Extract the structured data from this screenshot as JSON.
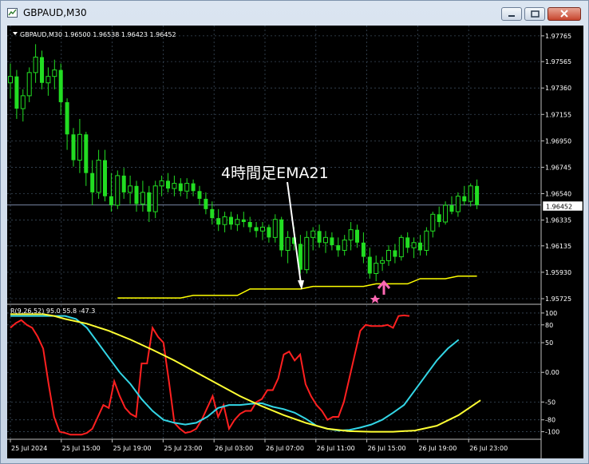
{
  "window": {
    "title": "GBPAUD,M30",
    "controls": [
      "minimize",
      "maximize",
      "close"
    ]
  },
  "main_chart": {
    "header": "GBPAUD,M30  1.96500 1.96538 1.96423 1.96452",
    "annotation": "4時間足EMA21",
    "current_price": "1.96452",
    "price_ticks": [
      "1.97765",
      "1.97565",
      "1.97360",
      "1.97155",
      "1.96950",
      "1.96745",
      "1.96540",
      "1.96335",
      "1.96135",
      "1.95930",
      "1.95725"
    ]
  },
  "sub_chart": {
    "header": "R(9,26,52) 95.0 55.8 -47.3",
    "ticks": [
      "100",
      "80",
      "50",
      "0.00",
      "-50",
      "-80",
      "-100"
    ]
  },
  "time_labels": [
    "25 Jul 2024",
    "25 Jul 15:00",
    "25 Jul 19:00",
    "25 Jul 23:00",
    "26 Jul 03:00",
    "26 Jul 07:00",
    "26 Jul 11:00",
    "26 Jul 15:00",
    "26 Jul 19:00",
    "26 Jul 23:00"
  ],
  "colors": {
    "background": "#000000",
    "grid": "#3a4a5a",
    "candle": "#22dd22",
    "ema": "#ffff00",
    "rci_short": "#ff2020",
    "rci_mid": "#33d6e6",
    "rci_long": "#ffff33",
    "signal": "#ff69b4"
  },
  "chart_data": [
    {
      "type": "candlestick",
      "title": "GBPAUD,M30",
      "ylim": [
        1.957,
        1.9782
      ],
      "price_format": "1.96452",
      "ohlc": [
        [
          1.974,
          1.9755,
          1.9728,
          1.9745
        ],
        [
          1.9745,
          1.975,
          1.9712,
          1.972
        ],
        [
          1.972,
          1.9735,
          1.971,
          1.973
        ],
        [
          1.973,
          1.9752,
          1.9725,
          1.9748
        ],
        [
          1.9748,
          1.977,
          1.974,
          1.976
        ],
        [
          1.976,
          1.9765,
          1.9735,
          1.974
        ],
        [
          1.974,
          1.9752,
          1.973,
          1.9745
        ],
        [
          1.9745,
          1.9758,
          1.9735,
          1.975
        ],
        [
          1.975,
          1.9755,
          1.9715,
          1.9725
        ],
        [
          1.9725,
          1.9728,
          1.9688,
          1.97
        ],
        [
          1.97,
          1.9705,
          1.9675,
          1.968
        ],
        [
          1.968,
          1.9712,
          1.967,
          1.97
        ],
        [
          1.97,
          1.9702,
          1.966,
          1.967
        ],
        [
          1.967,
          1.968,
          1.9645,
          1.9655
        ],
        [
          1.9655,
          1.9688,
          1.965,
          1.968
        ],
        [
          1.968,
          1.9688,
          1.9648,
          1.9652
        ],
        [
          1.9652,
          1.967,
          1.964,
          1.9645
        ],
        [
          1.9645,
          1.9672,
          1.9642,
          1.9668
        ],
        [
          1.9668,
          1.9674,
          1.965,
          1.9655
        ],
        [
          1.9655,
          1.9668,
          1.9646,
          1.966
        ],
        [
          1.966,
          1.9664,
          1.964,
          1.9646
        ],
        [
          1.9646,
          1.9664,
          1.964,
          1.9655
        ],
        [
          1.9655,
          1.966,
          1.9632,
          1.964
        ],
        [
          1.964,
          1.9664,
          1.9635,
          1.966
        ],
        [
          1.966,
          1.9668,
          1.9652,
          1.9664
        ],
        [
          1.9664,
          1.967,
          1.9655,
          1.9658
        ],
        [
          1.9658,
          1.9668,
          1.9652,
          1.9662
        ],
        [
          1.9662,
          1.9666,
          1.9652,
          1.9656
        ],
        [
          1.9656,
          1.9666,
          1.965,
          1.9662
        ],
        [
          1.9662,
          1.9665,
          1.9652,
          1.9656
        ],
        [
          1.9656,
          1.966,
          1.9645,
          1.965
        ],
        [
          1.965,
          1.9655,
          1.9638,
          1.9642
        ],
        [
          1.9642,
          1.9648,
          1.963,
          1.9635
        ],
        [
          1.9635,
          1.9642,
          1.9625,
          1.963
        ],
        [
          1.963,
          1.964,
          1.9624,
          1.9636
        ],
        [
          1.9636,
          1.964,
          1.9626,
          1.963
        ],
        [
          1.963,
          1.9638,
          1.9625,
          1.9634
        ],
        [
          1.9634,
          1.964,
          1.9628,
          1.9632
        ],
        [
          1.9632,
          1.9636,
          1.9624,
          1.9628
        ],
        [
          1.9628,
          1.9632,
          1.962,
          1.9625
        ],
        [
          1.9625,
          1.9632,
          1.9618,
          1.9628
        ],
        [
          1.9628,
          1.963,
          1.9616,
          1.962
        ],
        [
          1.962,
          1.9638,
          1.9616,
          1.9634
        ],
        [
          1.9634,
          1.9636,
          1.9605,
          1.961
        ],
        [
          1.961,
          1.9625,
          1.96,
          1.962
        ],
        [
          1.962,
          1.9628,
          1.961,
          1.9615
        ],
        [
          1.9615,
          1.9622,
          1.9592,
          1.9595
        ],
        [
          1.9595,
          1.9625,
          1.9592,
          1.962
        ],
        [
          1.962,
          1.9628,
          1.961,
          1.9625
        ],
        [
          1.9625,
          1.963,
          1.9612,
          1.9616
        ],
        [
          1.9616,
          1.9625,
          1.9608,
          1.962
        ],
        [
          1.962,
          1.9624,
          1.961,
          1.9614
        ],
        [
          1.9614,
          1.962,
          1.9605,
          1.961
        ],
        [
          1.961,
          1.9622,
          1.9606,
          1.9618
        ],
        [
          1.9618,
          1.9632,
          1.961,
          1.9626
        ],
        [
          1.9626,
          1.963,
          1.9612,
          1.9616
        ],
        [
          1.9616,
          1.9624,
          1.96,
          1.9605
        ],
        [
          1.9605,
          1.9612,
          1.9588,
          1.9592
        ],
        [
          1.9592,
          1.9606,
          1.9586,
          1.96
        ],
        [
          1.96,
          1.9605,
          1.9594,
          1.9602
        ],
        [
          1.9602,
          1.9614,
          1.9598,
          1.961
        ],
        [
          1.961,
          1.9615,
          1.96,
          1.9605
        ],
        [
          1.9605,
          1.9622,
          1.9602,
          1.962
        ],
        [
          1.962,
          1.9624,
          1.9608,
          1.9612
        ],
        [
          1.9612,
          1.962,
          1.9604,
          1.9616
        ],
        [
          1.9616,
          1.9622,
          1.9606,
          1.961
        ],
        [
          1.961,
          1.9628,
          1.9606,
          1.9625
        ],
        [
          1.9625,
          1.964,
          1.962,
          1.9638
        ],
        [
          1.9638,
          1.9644,
          1.9628,
          1.9632
        ],
        [
          1.9632,
          1.9648,
          1.963,
          1.9645
        ],
        [
          1.9645,
          1.9652,
          1.9638,
          1.964
        ],
        [
          1.964,
          1.9655,
          1.9636,
          1.9652
        ],
        [
          1.9652,
          1.966,
          1.9645,
          1.9648
        ],
        [
          1.9648,
          1.9662,
          1.9644,
          1.966
        ],
        [
          1.966,
          1.9665,
          1.9642,
          1.9645
        ]
      ],
      "ema_4h_21": [
        [
          17,
          1.9573
        ],
        [
          27,
          1.9573
        ],
        [
          29,
          1.9575
        ],
        [
          36,
          1.9575
        ],
        [
          38,
          1.958
        ],
        [
          46,
          1.958
        ],
        [
          48,
          1.9582
        ],
        [
          56,
          1.9582
        ],
        [
          58,
          1.9584
        ],
        [
          63,
          1.9584
        ],
        [
          65,
          1.9588
        ],
        [
          69,
          1.9588
        ],
        [
          71,
          1.959
        ],
        [
          74,
          1.959
        ]
      ],
      "current_price": 1.96452,
      "signal_index": 58
    },
    {
      "type": "line",
      "title": "R(9,26,52) 95.0 55.8 -47.3",
      "ylim": [
        -110,
        112
      ],
      "x": [
        "25 Jul 2024",
        "25 Jul 15:00",
        "25 Jul 19:00",
        "25 Jul 23:00",
        "26 Jul 03:00",
        "26 Jul 07:00",
        "26 Jul 11:00",
        "26 Jul 15:00",
        "26 Jul 19:00",
        "26 Jul 23:00"
      ],
      "series": [
        {
          "color": "#ff2020",
          "values": [
            [
              0,
              75
            ],
            [
              1,
              83
            ],
            [
              2,
              88
            ],
            [
              3,
              80
            ],
            [
              4,
              75
            ],
            [
              5,
              60
            ],
            [
              6,
              40
            ],
            [
              7,
              -20
            ],
            [
              8,
              -75
            ],
            [
              9,
              -100
            ],
            [
              10,
              -102
            ],
            [
              11,
              -105
            ],
            [
              12,
              -105
            ],
            [
              13,
              -105
            ],
            [
              14,
              -102
            ],
            [
              15,
              -95
            ],
            [
              16,
              -75
            ],
            [
              17,
              -55
            ],
            [
              18,
              -60
            ],
            [
              19,
              -15
            ],
            [
              20,
              -40
            ],
            [
              21,
              -60
            ],
            [
              22,
              -70
            ],
            [
              23,
              -75
            ],
            [
              24,
              15
            ],
            [
              25,
              15
            ],
            [
              26,
              75
            ],
            [
              27,
              60
            ],
            [
              28,
              50
            ],
            [
              29,
              -15
            ],
            [
              30,
              -85
            ],
            [
              31,
              -95
            ],
            [
              32,
              -102
            ],
            [
              33,
              -100
            ],
            [
              34,
              -95
            ],
            [
              35,
              -80
            ],
            [
              36,
              -60
            ],
            [
              37,
              -40
            ],
            [
              38,
              -75
            ],
            [
              39,
              -55
            ],
            [
              40,
              -95
            ],
            [
              41,
              -80
            ],
            [
              42,
              -70
            ],
            [
              43,
              -65
            ],
            [
              44,
              -65
            ],
            [
              45,
              -50
            ],
            [
              46,
              -45
            ],
            [
              47,
              -30
            ],
            [
              48,
              -30
            ],
            [
              49,
              -10
            ],
            [
              50,
              30
            ],
            [
              51,
              35
            ],
            [
              52,
              20
            ],
            [
              53,
              30
            ],
            [
              54,
              -20
            ],
            [
              55,
              -40
            ],
            [
              56,
              -55
            ],
            [
              57,
              -65
            ],
            [
              58,
              -80
            ],
            [
              59,
              -75
            ],
            [
              60,
              -75
            ],
            [
              61,
              -50
            ],
            [
              62,
              -10
            ],
            [
              63,
              30
            ],
            [
              64,
              70
            ],
            [
              65,
              80
            ],
            [
              66,
              78
            ],
            [
              67,
              78
            ],
            [
              68,
              78
            ],
            [
              69,
              80
            ],
            [
              70,
              75
            ],
            [
              71,
              95
            ],
            [
              72,
              96
            ],
            [
              73,
              95
            ]
          ]
        },
        {
          "color": "#33d6e6",
          "values": [
            [
              0,
              95
            ],
            [
              10,
              95
            ],
            [
              12,
              90
            ],
            [
              14,
              75
            ],
            [
              16,
              50
            ],
            [
              18,
              25
            ],
            [
              20,
              0
            ],
            [
              22,
              -20
            ],
            [
              24,
              -45
            ],
            [
              26,
              -65
            ],
            [
              28,
              -80
            ],
            [
              30,
              -85
            ],
            [
              32,
              -88
            ],
            [
              34,
              -85
            ],
            [
              36,
              -75
            ],
            [
              38,
              -60
            ],
            [
              40,
              -55
            ],
            [
              42,
              -55
            ],
            [
              44,
              -53
            ],
            [
              46,
              -52
            ],
            [
              48,
              -58
            ],
            [
              50,
              -62
            ],
            [
              52,
              -68
            ],
            [
              54,
              -78
            ],
            [
              56,
              -90
            ],
            [
              58,
              -95
            ],
            [
              60,
              -98
            ],
            [
              62,
              -97
            ],
            [
              64,
              -93
            ],
            [
              66,
              -88
            ],
            [
              68,
              -80
            ],
            [
              70,
              -68
            ],
            [
              72,
              -55
            ],
            [
              74,
              -30
            ],
            [
              76,
              -5
            ],
            [
              78,
              20
            ],
            [
              80,
              40
            ],
            [
              82,
              55
            ]
          ]
        },
        {
          "color": "#ffff33",
          "values": [
            [
              0,
              98
            ],
            [
              6,
              98
            ],
            [
              8,
              95
            ],
            [
              10,
              90
            ],
            [
              14,
              82
            ],
            [
              18,
              70
            ],
            [
              22,
              55
            ],
            [
              26,
              38
            ],
            [
              30,
              20
            ],
            [
              34,
              0
            ],
            [
              38,
              -20
            ],
            [
              42,
              -40
            ],
            [
              46,
              -57
            ],
            [
              50,
              -72
            ],
            [
              54,
              -85
            ],
            [
              58,
              -95
            ],
            [
              62,
              -99
            ],
            [
              66,
              -100
            ],
            [
              70,
              -100
            ],
            [
              74,
              -98
            ],
            [
              78,
              -90
            ],
            [
              82,
              -72
            ],
            [
              86,
              -47
            ]
          ]
        }
      ]
    }
  ]
}
